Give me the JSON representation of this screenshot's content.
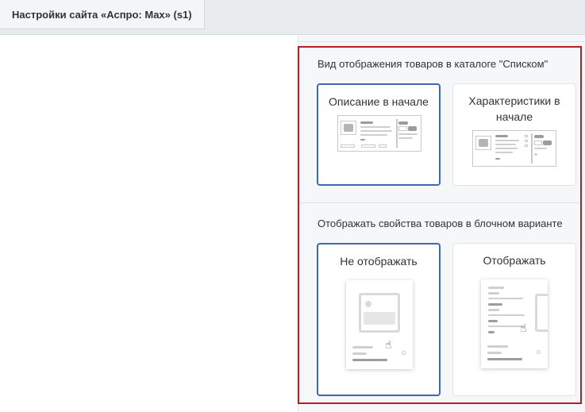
{
  "tab": {
    "title": "Настройки сайта «Аспро: Max» (s1)"
  },
  "sections": [
    {
      "title": "Вид отображения товаров в каталоге \"Списком\"",
      "options": [
        {
          "label": "Описание в начале",
          "selected": true,
          "icon": "list-description-first-preview"
        },
        {
          "label": "Характеристики в начале",
          "selected": false,
          "icon": "list-properties-first-preview"
        }
      ]
    },
    {
      "title": "Отображать свойства товаров в блочном варианте",
      "options": [
        {
          "label": "Не отображать",
          "selected": true,
          "icon": "block-no-properties-preview"
        },
        {
          "label": "Отображать",
          "selected": false,
          "icon": "block-with-properties-preview"
        }
      ]
    }
  ],
  "colors": {
    "selected_border": "#3f68b0",
    "highlight_frame": "#b42025"
  }
}
